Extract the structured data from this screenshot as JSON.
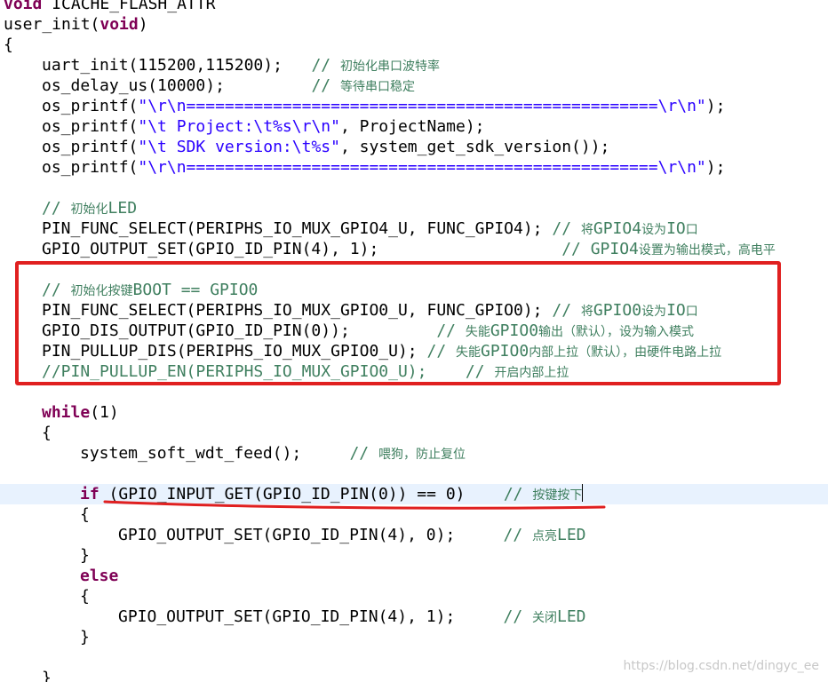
{
  "editor": {
    "lines": [
      {
        "indent": 0,
        "tokens": [
          {
            "t": "kw",
            "v": "void"
          },
          {
            "t": "plain",
            "v": " ICACHE_FLASH_ATTR"
          }
        ]
      },
      {
        "indent": 0,
        "tokens": [
          {
            "t": "plain",
            "v": "user_init("
          },
          {
            "t": "kw",
            "v": "void"
          },
          {
            "t": "plain",
            "v": ")"
          }
        ]
      },
      {
        "indent": 0,
        "tokens": [
          {
            "t": "plain",
            "v": "{"
          }
        ]
      },
      {
        "indent": 1,
        "tokens": [
          {
            "t": "plain",
            "v": "uart_init(115200,115200);   "
          },
          {
            "t": "cmt",
            "v": "// "
          },
          {
            "t": "cmtcn",
            "v": "初始化串口波特率"
          }
        ]
      },
      {
        "indent": 1,
        "tokens": [
          {
            "t": "plain",
            "v": "os_delay_us(10000);         "
          },
          {
            "t": "cmt",
            "v": "// "
          },
          {
            "t": "cmtcn",
            "v": "等待串口稳定"
          }
        ]
      },
      {
        "indent": 1,
        "tokens": [
          {
            "t": "plain",
            "v": "os_printf("
          },
          {
            "t": "str",
            "v": "\"\\r\\n=================================================\\r\\n\""
          },
          {
            "t": "plain",
            "v": ");"
          }
        ]
      },
      {
        "indent": 1,
        "tokens": [
          {
            "t": "plain",
            "v": "os_printf("
          },
          {
            "t": "str",
            "v": "\"\\t Project:\\t%s\\r\\n\""
          },
          {
            "t": "plain",
            "v": ", ProjectName);"
          }
        ]
      },
      {
        "indent": 1,
        "tokens": [
          {
            "t": "plain",
            "v": "os_printf("
          },
          {
            "t": "str",
            "v": "\"\\t SDK version:\\t%s\""
          },
          {
            "t": "plain",
            "v": ", system_get_sdk_version());"
          }
        ]
      },
      {
        "indent": 1,
        "tokens": [
          {
            "t": "plain",
            "v": "os_printf("
          },
          {
            "t": "str",
            "v": "\"\\r\\n=================================================\\r\\n\""
          },
          {
            "t": "plain",
            "v": ");"
          }
        ]
      },
      {
        "indent": 0,
        "tokens": []
      },
      {
        "indent": 1,
        "tokens": [
          {
            "t": "cmt",
            "v": "// "
          },
          {
            "t": "cmtcn",
            "v": "初始化"
          },
          {
            "t": "cmt",
            "v": "LED"
          }
        ]
      },
      {
        "indent": 1,
        "tokens": [
          {
            "t": "plain",
            "v": "PIN_FUNC_SELECT(PERIPHS_IO_MUX_GPIO4_U, FUNC_GPIO4); "
          },
          {
            "t": "cmt",
            "v": "// "
          },
          {
            "t": "cmtcn",
            "v": "将"
          },
          {
            "t": "cmt",
            "v": "GPIO4"
          },
          {
            "t": "cmtcn",
            "v": "设为"
          },
          {
            "t": "cmt",
            "v": "IO"
          },
          {
            "t": "cmtcn",
            "v": "口"
          }
        ]
      },
      {
        "indent": 1,
        "tokens": [
          {
            "t": "plain",
            "v": "GPIO_OUTPUT_SET(GPIO_ID_PIN(4), 1);                   "
          },
          {
            "t": "cmt",
            "v": "// GPIO4"
          },
          {
            "t": "cmtcn",
            "v": "设置为输出模式，高电平"
          }
        ]
      },
      {
        "indent": 0,
        "tokens": []
      },
      {
        "indent": 1,
        "tokens": [
          {
            "t": "cmt",
            "v": "// "
          },
          {
            "t": "cmtcn",
            "v": "初始化按键"
          },
          {
            "t": "cmt",
            "v": "BOOT == GPIO0"
          }
        ]
      },
      {
        "indent": 1,
        "tokens": [
          {
            "t": "plain",
            "v": "PIN_FUNC_SELECT(PERIPHS_IO_MUX_GPIO0_U, FUNC_GPIO0); "
          },
          {
            "t": "cmt",
            "v": "// "
          },
          {
            "t": "cmtcn",
            "v": "将"
          },
          {
            "t": "cmt",
            "v": "GPIO0"
          },
          {
            "t": "cmtcn",
            "v": "设为"
          },
          {
            "t": "cmt",
            "v": "IO"
          },
          {
            "t": "cmtcn",
            "v": "口"
          }
        ]
      },
      {
        "indent": 1,
        "tokens": [
          {
            "t": "plain",
            "v": "GPIO_DIS_OUTPUT(GPIO_ID_PIN(0));         "
          },
          {
            "t": "cmt",
            "v": "// "
          },
          {
            "t": "cmtcn",
            "v": "失能"
          },
          {
            "t": "cmt",
            "v": "GPIO0"
          },
          {
            "t": "cmtcn",
            "v": "输出（默认），设为输入模式"
          }
        ]
      },
      {
        "indent": 1,
        "tokens": [
          {
            "t": "plain",
            "v": "PIN_PULLUP_DIS(PERIPHS_IO_MUX_GPIO0_U); "
          },
          {
            "t": "cmt",
            "v": "// "
          },
          {
            "t": "cmtcn",
            "v": "失能"
          },
          {
            "t": "cmt",
            "v": "GPIO0"
          },
          {
            "t": "cmtcn",
            "v": "内部上拉（默认），由硬件电路上拉"
          }
        ]
      },
      {
        "indent": 1,
        "tokens": [
          {
            "t": "cmt",
            "v": "//PIN_PULLUP_EN(PERIPHS_IO_MUX_GPIO0_U);    // "
          },
          {
            "t": "cmtcn",
            "v": "开启内部上拉"
          }
        ]
      },
      {
        "indent": 0,
        "tokens": []
      },
      {
        "indent": 1,
        "tokens": [
          {
            "t": "kw",
            "v": "while"
          },
          {
            "t": "plain",
            "v": "(1)"
          }
        ]
      },
      {
        "indent": 1,
        "tokens": [
          {
            "t": "plain",
            "v": "{"
          }
        ]
      },
      {
        "indent": 2,
        "tokens": [
          {
            "t": "plain",
            "v": "system_soft_wdt_feed();     "
          },
          {
            "t": "cmt",
            "v": "// "
          },
          {
            "t": "cmtcn",
            "v": "喂狗，防止复位"
          }
        ]
      },
      {
        "indent": 0,
        "tokens": []
      },
      {
        "indent": 2,
        "current": true,
        "tokens": [
          {
            "t": "kw",
            "v": "if"
          },
          {
            "t": "plain",
            "v": " (GPIO_INPUT_GET(GPIO_ID_PIN(0)) == 0)    "
          },
          {
            "t": "cmt",
            "v": "// "
          },
          {
            "t": "cmtcn",
            "v": "按键按下"
          },
          {
            "t": "cursor",
            "v": ""
          }
        ]
      },
      {
        "indent": 2,
        "tokens": [
          {
            "t": "plain",
            "v": "{"
          }
        ]
      },
      {
        "indent": 3,
        "tokens": [
          {
            "t": "plain",
            "v": "GPIO_OUTPUT_SET(GPIO_ID_PIN(4), 0);     "
          },
          {
            "t": "cmt",
            "v": "// "
          },
          {
            "t": "cmtcn",
            "v": "点亮"
          },
          {
            "t": "cmt",
            "v": "LED"
          }
        ]
      },
      {
        "indent": 2,
        "tokens": [
          {
            "t": "plain",
            "v": "}"
          }
        ]
      },
      {
        "indent": 2,
        "tokens": [
          {
            "t": "kw",
            "v": "else"
          }
        ]
      },
      {
        "indent": 2,
        "tokens": [
          {
            "t": "plain",
            "v": "{"
          }
        ]
      },
      {
        "indent": 3,
        "tokens": [
          {
            "t": "plain",
            "v": "GPIO_OUTPUT_SET(GPIO_ID_PIN(4), 1);     "
          },
          {
            "t": "cmt",
            "v": "// "
          },
          {
            "t": "cmtcn",
            "v": "关闭"
          },
          {
            "t": "cmt",
            "v": "LED"
          }
        ]
      },
      {
        "indent": 2,
        "tokens": [
          {
            "t": "plain",
            "v": "}"
          }
        ]
      },
      {
        "indent": 0,
        "tokens": []
      },
      {
        "indent": 1,
        "tokens": [
          {
            "t": "plain",
            "v": "}"
          }
        ]
      }
    ]
  },
  "colors": {
    "keyword": "#7f0055",
    "string": "#2a00ff",
    "comment": "#3f7f5f",
    "current_line": "#e8f2fe",
    "annotation": "#e02020"
  },
  "watermark": "https://blog.csdn.net/dingyc_ee"
}
